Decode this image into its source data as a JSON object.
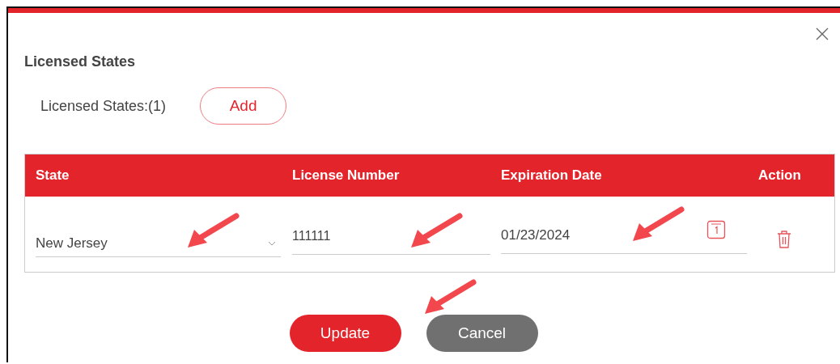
{
  "dialog": {
    "title": "Licensed States",
    "count_label": "Licensed States:(1)",
    "add_button": "Add"
  },
  "table": {
    "columns": [
      "State",
      "License Number",
      "Expiration Date",
      "Action"
    ],
    "rows": [
      {
        "state": "New Jersey",
        "license_number": "111111",
        "expiration_date": "01/23/2024"
      }
    ]
  },
  "buttons": [
    {
      "label": "Update",
      "kind": "primary"
    },
    {
      "label": "Cancel",
      "kind": "secondary"
    }
  ]
}
